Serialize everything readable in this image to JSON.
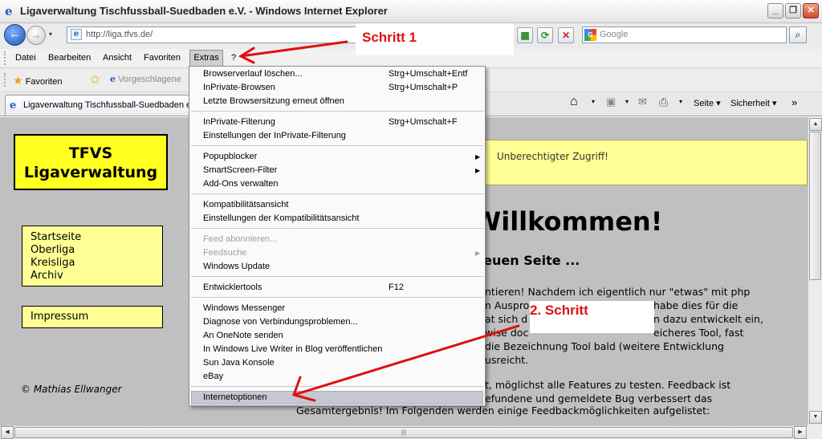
{
  "window": {
    "title": "Ligaverwaltung Tischfussball-Suedbaden e.V. - Windows Internet Explorer",
    "minimize": "_",
    "maximize": "❐",
    "close": "✕"
  },
  "address_bar": {
    "url": "http://liga.tfvs.de/",
    "search_placeholder": "Google",
    "back": "←",
    "forward": "→",
    "dropdown": "▾"
  },
  "menubar": {
    "items": [
      "Datei",
      "Bearbeiten",
      "Ansicht",
      "Favoriten",
      "Extras",
      "?"
    ]
  },
  "favorites_bar": {
    "favorites_label": "Favoriten",
    "suggested_label": "Vorgeschlagene"
  },
  "tab": {
    "title": "Ligaverwaltung Tischfussball-Suedbaden e.V."
  },
  "command_bar": {
    "page": "Seite",
    "security": "Sicherheit",
    "more": "»"
  },
  "extras_menu": {
    "items": [
      {
        "label": "Browserverlauf löschen...",
        "shortcut": "Strg+Umschalt+Entf"
      },
      {
        "label": "InPrivate-Browsen",
        "shortcut": "Strg+Umschalt+P"
      },
      {
        "label": "Letzte Browsersitzung erneut öffnen",
        "shortcut": ""
      },
      {
        "label": "InPrivate-Filterung",
        "shortcut": "Strg+Umschalt+F"
      },
      {
        "label": "Einstellungen der InPrivate-Filterung",
        "shortcut": ""
      },
      {
        "label": "Popupblocker",
        "shortcut": ""
      },
      {
        "label": "SmartScreen-Filter",
        "shortcut": ""
      },
      {
        "label": "Add-Ons verwalten",
        "shortcut": ""
      },
      {
        "label": "Kompatibilitätsansicht",
        "shortcut": ""
      },
      {
        "label": "Einstellungen der Kompatibilitätsansicht",
        "shortcut": ""
      },
      {
        "label": "Feed abonnieren...",
        "shortcut": ""
      },
      {
        "label": "Feedsuche",
        "shortcut": ""
      },
      {
        "label": "Windows Update",
        "shortcut": ""
      },
      {
        "label": "Entwicklertools",
        "shortcut": "F12"
      },
      {
        "label": "Windows Messenger",
        "shortcut": ""
      },
      {
        "label": "Diagnose von Verbindungsproblemen...",
        "shortcut": ""
      },
      {
        "label": "An OneNote senden",
        "shortcut": ""
      },
      {
        "label": "In Windows Live Writer in Blog veröffentlichen",
        "shortcut": ""
      },
      {
        "label": "Sun Java Konsole",
        "shortcut": ""
      },
      {
        "label": "eBay",
        "shortcut": ""
      },
      {
        "label": "Internetoptionen",
        "shortcut": ""
      }
    ]
  },
  "page": {
    "logo_line1": "TFVS",
    "logo_line2": "Ligaverwaltung",
    "nav": [
      "Startseite",
      "Oberliga",
      "Kreisliga",
      "Archiv"
    ],
    "impressum": "Impressum",
    "author": "© Mathias Ellwanger",
    "warning": "Unberechtigter Zugriff!",
    "welcome": "n Willkommen!",
    "subhead": "der neuen Seite ...",
    "para1": [
      "ntieren! Nachdem ich eigentlich nur \"etwas\" mit php",
      "n Ausprob",
      "habe dies für die",
      "at sich d",
      "n dazu entwickelt ein,",
      "wise doc",
      "eicheres Tool, fast",
      "die Bezeichnung Tool bald (weitere Entwicklung",
      "usreicht."
    ],
    "para2": [
      "t, möglichst alle Features zu testen. Feedback ist",
      "efundene und gemeldete Bug verbessert das",
      "Gesamtergebnis! Im Folgenden werden einige Feedbackmöglichkeiten aufgelistet:"
    ]
  },
  "annotations": {
    "step1": "Schritt 1",
    "step2": "2. Schritt",
    "color": "#e01010"
  }
}
